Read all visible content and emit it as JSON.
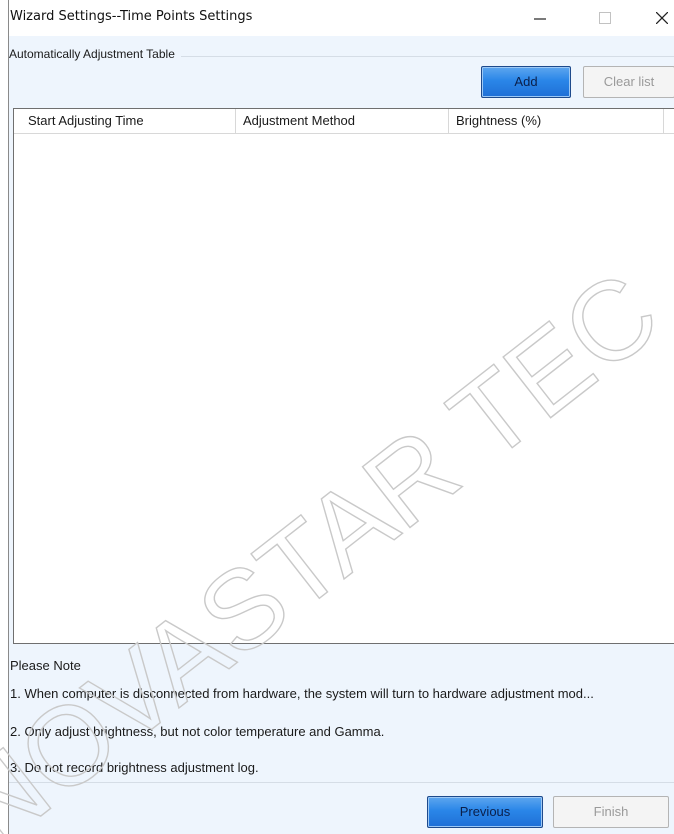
{
  "window": {
    "title": "Wizard Settings--Time Points Settings",
    "controls": {
      "minimize": "minimize-icon",
      "maximize": "maximize-icon",
      "close": "close-icon"
    }
  },
  "group": {
    "label": "Automatically Adjustment Table",
    "add_label": "Add",
    "clear_label": "Clear list"
  },
  "table": {
    "columns": [
      "Start Adjusting Time",
      "Adjustment Method",
      "Brightness (%)"
    ],
    "rows": []
  },
  "notes": {
    "heading": "Please Note",
    "items": [
      "1. When computer is disconnected from hardware, the system will turn to hardware adjustment mod...",
      "2. Only adjust brightness, but not color temperature and Gamma.",
      "3. Do not record brightness adjustment log."
    ]
  },
  "footer": {
    "previous_label": "Previous",
    "finish_label": "Finish"
  },
  "watermark": {
    "text": "NOVASTAR TEC"
  },
  "colors": {
    "window_bg": "#eef5fd",
    "primary_button": "#2a86e8",
    "table_bg": "#ffffff"
  }
}
